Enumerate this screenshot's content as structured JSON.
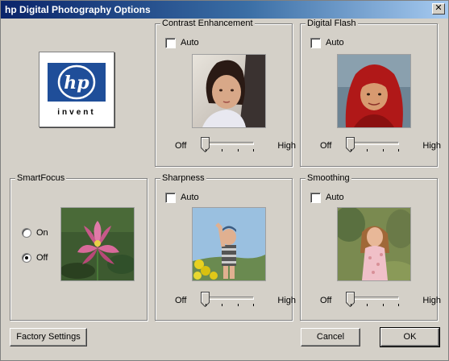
{
  "window": {
    "title": "hp Digital Photography Options",
    "close_glyph": "✕"
  },
  "logo": {
    "icon": "hp-invent-logo",
    "text_mark": "hp",
    "tagline": "invent",
    "brand_color": "#1f4e99"
  },
  "contrast": {
    "title": "Contrast Enhancement",
    "auto_label": "Auto",
    "auto_checked": false,
    "slider_off_label": "Off",
    "slider_high_label": "High",
    "slider_level": 0
  },
  "flash": {
    "title": "Digital Flash",
    "auto_label": "Auto",
    "auto_checked": false,
    "slider_off_label": "Off",
    "slider_high_label": "High",
    "slider_level": 0
  },
  "smartfocus": {
    "title": "SmartFocus",
    "on_label": "On",
    "off_label": "Off",
    "selected": "Off"
  },
  "sharpness": {
    "title": "Sharpness",
    "auto_label": "Auto",
    "auto_checked": false,
    "slider_off_label": "Off",
    "slider_high_label": "High",
    "slider_level": 0
  },
  "smoothing": {
    "title": "Smoothing",
    "auto_label": "Auto",
    "auto_checked": false,
    "slider_off_label": "Off",
    "slider_high_label": "High",
    "slider_level": 0
  },
  "buttons": {
    "factory": "Factory Settings",
    "cancel": "Cancel",
    "ok": "OK"
  },
  "colors": {
    "dialog_background": "#d4d0c8",
    "titlebar_start": "#0a246a",
    "titlebar_end": "#a6caf0"
  }
}
